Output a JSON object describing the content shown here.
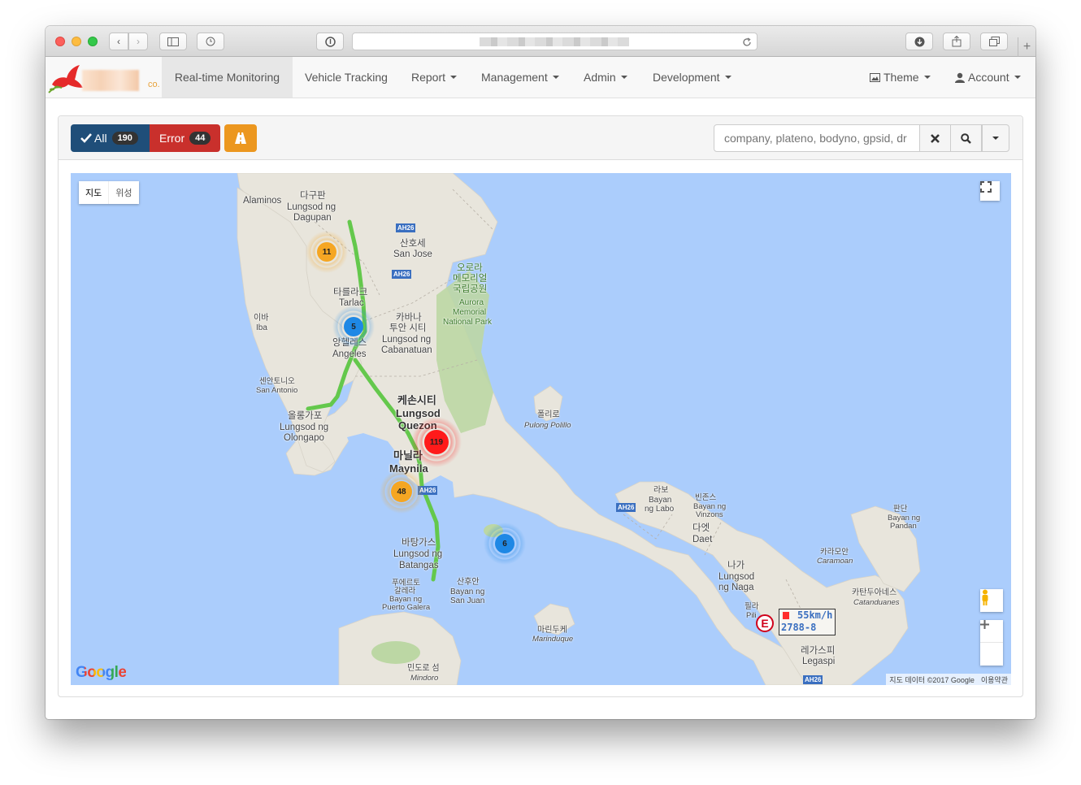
{
  "browser": {
    "new_tab_symbol": "+"
  },
  "navbar": {
    "brand_suffix": "co.",
    "items": [
      {
        "label": "Real-time Monitoring",
        "active": true
      },
      {
        "label": "Vehicle Tracking"
      },
      {
        "label": "Report"
      },
      {
        "label": "Management"
      },
      {
        "label": "Admin"
      },
      {
        "label": "Development"
      }
    ],
    "theme_label": "Theme",
    "account_label": "Account"
  },
  "toolbar": {
    "all_label": "All",
    "all_count": "190",
    "error_label": "Error",
    "error_count": "44",
    "warning_icon": "road-icon",
    "search_placeholder": "company, plateno, bodyno, gpsid, dr"
  },
  "colors": {
    "all_button": "#1f4e79",
    "error_button": "#c9302c",
    "warning_button": "#ec971f",
    "cluster_red": "#ff1a1a",
    "cluster_orange": "#f5a623",
    "cluster_blue": "#1e88e5",
    "route": "#64c84c"
  },
  "map": {
    "type_map": "지도",
    "type_satellite": "위성",
    "clusters": [
      {
        "count": "11",
        "level": "orange"
      },
      {
        "count": "5",
        "level": "blue"
      },
      {
        "count": "119",
        "level": "red"
      },
      {
        "count": "48",
        "level": "orange"
      },
      {
        "count": "6",
        "level": "blue"
      }
    ],
    "places": [
      {
        "name": "Alaminos"
      },
      {
        "name": "다구판"
      },
      {
        "name": "Lungsod ng"
      },
      {
        "name": "Dagupan"
      },
      {
        "name": "산호세"
      },
      {
        "name": "San Jose"
      },
      {
        "name": "오로라"
      },
      {
        "name": "메모리얼"
      },
      {
        "name": "국립공원"
      },
      {
        "name": "Aurora"
      },
      {
        "name": "Memorial"
      },
      {
        "name": "National Park"
      },
      {
        "name": "타를라크"
      },
      {
        "name": "Tarlac"
      },
      {
        "name": "이바"
      },
      {
        "name": "Iba"
      },
      {
        "name": "카바나"
      },
      {
        "name": "투안 시티"
      },
      {
        "name": "Lungsod ng"
      },
      {
        "name": "Cabanatuan"
      },
      {
        "name": "앙헬레스"
      },
      {
        "name": "Angeles"
      },
      {
        "name": "센안토니오"
      },
      {
        "name": "San Antonio"
      },
      {
        "name": "케손시티"
      },
      {
        "name": "Lungsod"
      },
      {
        "name": "Quezon"
      },
      {
        "name": "올롱가포"
      },
      {
        "name": "Lungsod ng"
      },
      {
        "name": "Olongapo"
      },
      {
        "name": "폴리로"
      },
      {
        "name": "Pulong Polillo"
      },
      {
        "name": "마닐라"
      },
      {
        "name": "Maynila"
      },
      {
        "name": "바탕가스"
      },
      {
        "name": "Lungsod ng"
      },
      {
        "name": "Batangas"
      },
      {
        "name": "푸에르토"
      },
      {
        "name": "갈레라"
      },
      {
        "name": "Bayan ng"
      },
      {
        "name": "Puerto Galera"
      },
      {
        "name": "산후안"
      },
      {
        "name": "Bayan ng"
      },
      {
        "name": "San Juan"
      },
      {
        "name": "라보"
      },
      {
        "name": "Bayan"
      },
      {
        "name": "ng Labo"
      },
      {
        "name": "빈존스"
      },
      {
        "name": "Bayan ng"
      },
      {
        "name": "Vinzons"
      },
      {
        "name": "다엣"
      },
      {
        "name": "Daet"
      },
      {
        "name": "판단"
      },
      {
        "name": "Bayan ng"
      },
      {
        "name": "Pandan"
      },
      {
        "name": "카라모안"
      },
      {
        "name": "Caramoan"
      },
      {
        "name": "나가"
      },
      {
        "name": "Lungsod"
      },
      {
        "name": "ng Naga"
      },
      {
        "name": "카탄두아네스"
      },
      {
        "name": "Catanduanes"
      },
      {
        "name": "필라"
      },
      {
        "name": "Pili"
      },
      {
        "name": "마린두케"
      },
      {
        "name": "Marinduque"
      },
      {
        "name": "레가스피"
      },
      {
        "name": "Legaspi"
      },
      {
        "name": "민도로 섬"
      },
      {
        "name": "Mindoro"
      }
    ],
    "highways": [
      "AH26",
      "AH26",
      "AH26",
      "AH26",
      "AH26"
    ],
    "vehicle": {
      "marker": "E",
      "speed": "55km/h",
      "plate": "2788-8"
    },
    "google_logo": "Google",
    "attribution": "지도 데이터 ©2017 Google",
    "terms": "이용약관"
  }
}
